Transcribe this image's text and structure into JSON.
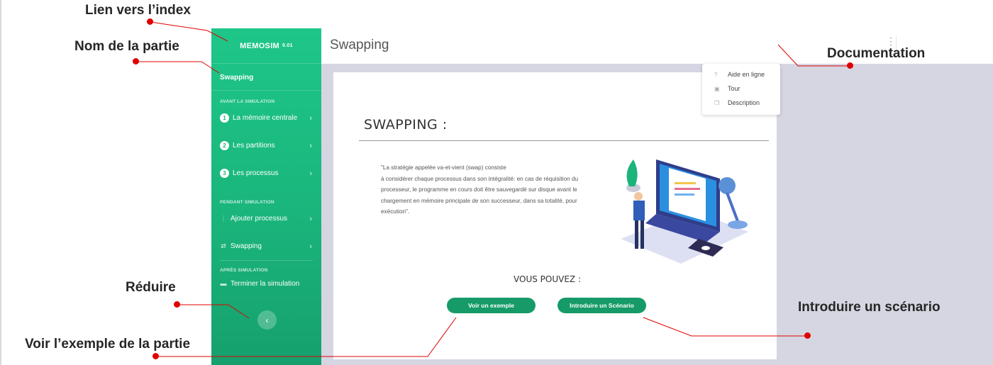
{
  "annotations": {
    "index_link": "Lien vers l’index",
    "part_name": "Nom de la partie",
    "documentation": "Documentation",
    "collapse": "Réduire",
    "example": "Voir l’exemple de la partie",
    "scenario": "Introduire un scénario"
  },
  "app": {
    "brand": "MEMOSIM",
    "version": "0.01",
    "page_title": "Swapping"
  },
  "sidebar": {
    "part": "Swapping",
    "sections": [
      {
        "title": "AVANT LA SIMULATION"
      },
      {
        "title": "PENDANT SIMULATION"
      },
      {
        "title": "APRÈS SIMULATION"
      }
    ],
    "before": [
      {
        "num": "1",
        "label": "La mémoire centrale"
      },
      {
        "num": "2",
        "label": "Les partitions"
      },
      {
        "num": "3",
        "label": "Les processus"
      }
    ],
    "during": [
      {
        "icon": "vertical-dots-icon",
        "label": "Ajouter processus"
      },
      {
        "icon": "swap-icon",
        "label": "Swapping"
      }
    ],
    "after": [
      {
        "icon": "flag-icon",
        "label": "Terminer la simulation"
      }
    ],
    "collapse_icon": "chevron-left-icon"
  },
  "menu": {
    "items": [
      {
        "icon": "help-icon",
        "label": "Aide en ligne"
      },
      {
        "icon": "film-icon",
        "label": "Tour"
      },
      {
        "icon": "copy-icon",
        "label": "Description"
      }
    ]
  },
  "main": {
    "heading": "SWAPPING :",
    "quote_lines": [
      "\"La stratégie appelée va-et-vient (swap) consiste",
      "à considérer chaque processus dans son intégralité: en cas de réquisition du",
      "processeur, le programme en cours doit être sauvegardé sur disque avant le",
      "chargement en mémoire principale de son successeur, dans sa totalité, pour",
      "exécution\"."
    ],
    "vous_pouvez": "VOUS POUVEZ :",
    "btn_example": "Voir un exemple",
    "btn_scenario": "Introduire un Scénario"
  },
  "colors": {
    "sidebar_green": "#1ab57c",
    "button_green": "#169b68",
    "annotation_red": "#e00000"
  }
}
